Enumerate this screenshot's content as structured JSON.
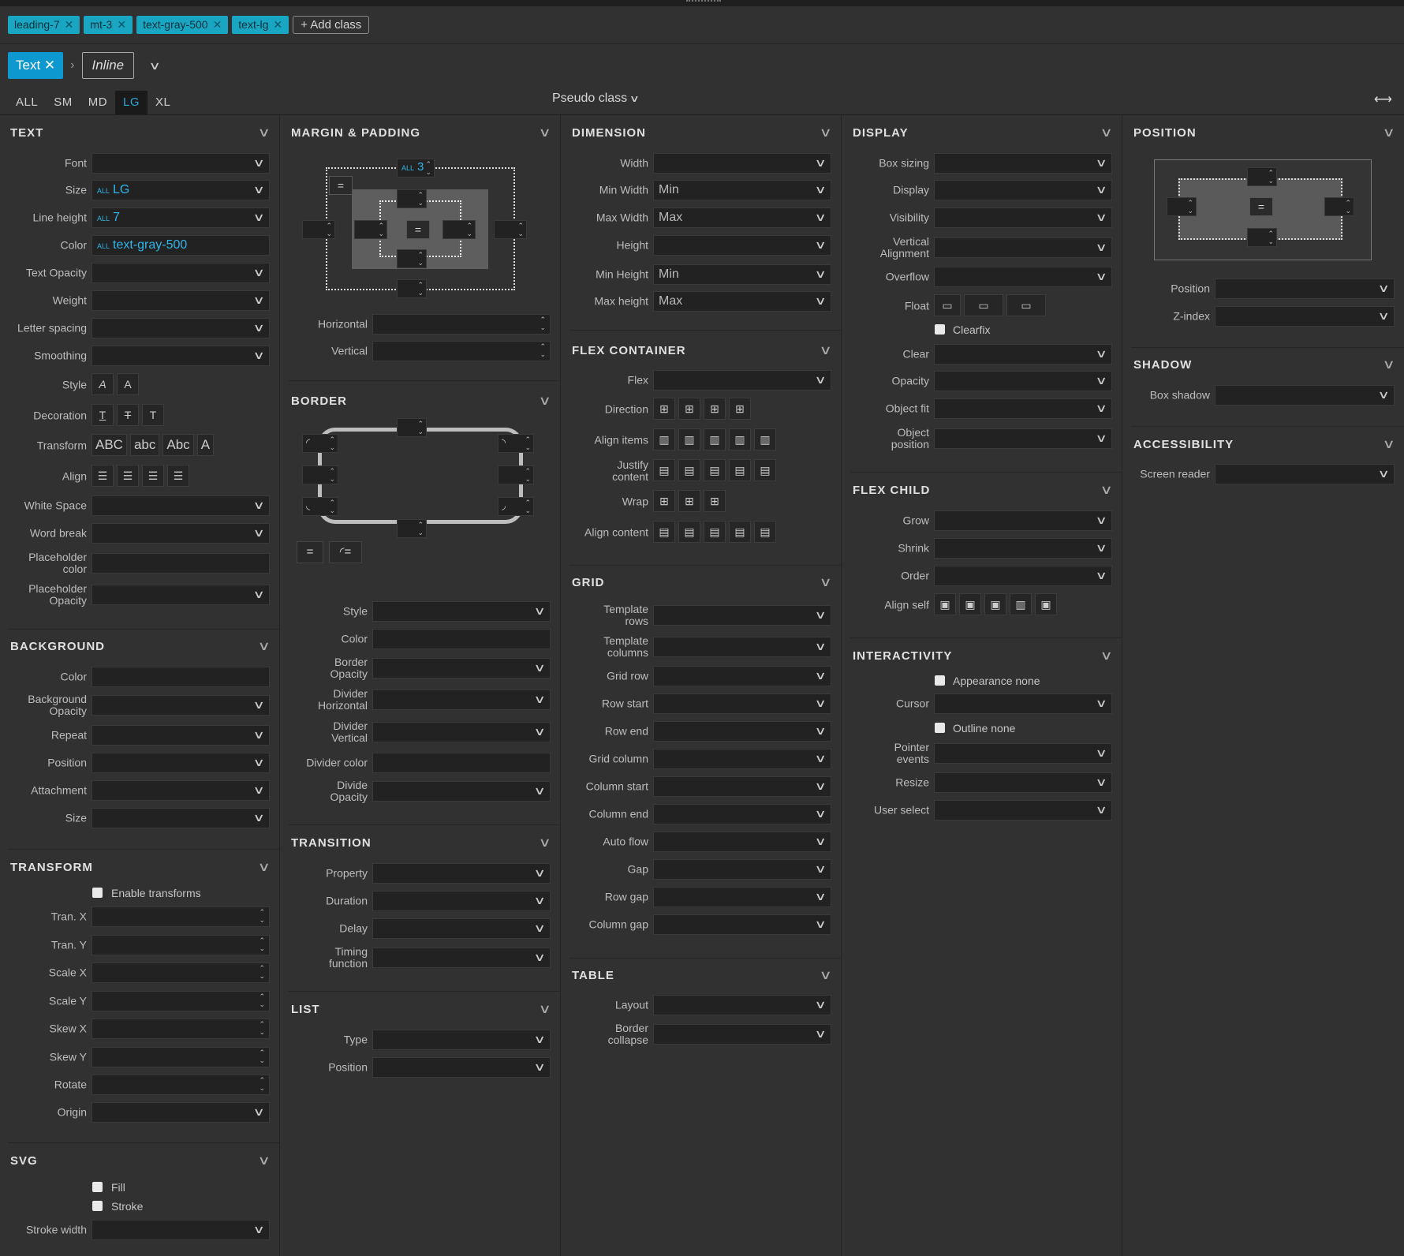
{
  "classes": {
    "items": [
      "leading-7",
      "mt-3",
      "text-gray-500",
      "text-lg"
    ],
    "add_label": "+ Add class"
  },
  "selector": {
    "tag": "Text",
    "state": "Inline"
  },
  "breakpoints": {
    "items": [
      "ALL",
      "SM",
      "MD",
      "LG",
      "XL"
    ],
    "active": "LG"
  },
  "pseudo_label": "Pseudo class",
  "text": {
    "title": "TEXT",
    "font": "Font",
    "size": "Size",
    "size_all": "ALL",
    "size_val": "LG",
    "lh": "Line height",
    "lh_all": "ALL",
    "lh_val": "7",
    "color": "Color",
    "color_all": "ALL",
    "color_val": "text-gray-500",
    "opacity": "Text Opacity",
    "weight": "Weight",
    "ls": "Letter spacing",
    "smooth": "Smoothing",
    "style": "Style",
    "style_a": "A",
    "style_b": "A",
    "deco": "Decoration",
    "deco_a": "T",
    "deco_b": "T",
    "deco_c": "T",
    "transform": "Transform",
    "tr_a": "ABC",
    "tr_b": "abc",
    "tr_c": "Abc",
    "tr_d": "A",
    "align": "Align",
    "ws": "White Space",
    "wb": "Word break",
    "ph1": "Placeholder",
    "ph1b": "color",
    "ph2": "Placeholder",
    "ph2b": "Opacity"
  },
  "background": {
    "title": "BACKGROUND",
    "color": "Color",
    "op1": "Background",
    "op2": "Opacity",
    "repeat": "Repeat",
    "position": "Position",
    "attach": "Attachment",
    "size": "Size"
  },
  "transform": {
    "title": "TRANSFORM",
    "enable": "Enable transforms",
    "tx": "Tran. X",
    "ty": "Tran. Y",
    "sx": "Scale X",
    "sy": "Scale Y",
    "kx": "Skew X",
    "ky": "Skew Y",
    "rot": "Rotate",
    "origin": "Origin"
  },
  "svg": {
    "title": "SVG",
    "fill": "Fill",
    "stroke": "Stroke",
    "sw": "Stroke width"
  },
  "mp": {
    "title": "MARGIN & PADDING",
    "all": "ALL",
    "val": "3",
    "hz": "Horizontal",
    "vt": "Vertical"
  },
  "border": {
    "title": "BORDER",
    "style": "Style",
    "color": "Color",
    "bo1": "Border",
    "bo2": "Opacity",
    "dh1": "Divider",
    "dh2": "Horizontal",
    "dv1": "Divider",
    "dv2": "Vertical",
    "dc": "Divider color",
    "do1": "Divide",
    "do2": "Opacity"
  },
  "transition": {
    "title": "TRANSITION",
    "prop": "Property",
    "dur": "Duration",
    "delay": "Delay",
    "tf1": "Timing",
    "tf2": "function"
  },
  "list": {
    "title": "LIST",
    "type": "Type",
    "pos": "Position"
  },
  "dimension": {
    "title": "DIMENSION",
    "w": "Width",
    "minw": "Min Width",
    "minw_v": "Min",
    "maxw": "Max Width",
    "maxw_v": "Max",
    "h": "Height",
    "minh": "Min Height",
    "minh_v": "Min",
    "maxh": "Max height",
    "maxh_v": "Max"
  },
  "flex": {
    "title": "FLEX CONTAINER",
    "flex": "Flex",
    "dir": "Direction",
    "ai": "Align items",
    "jc1": "Justify",
    "jc2": "content",
    "wrap": "Wrap",
    "ac": "Align content"
  },
  "grid": {
    "title": "GRID",
    "tr1": "Template",
    "tr2": "rows",
    "tc1": "Template",
    "tc2": "columns",
    "gr": "Grid row",
    "rs": "Row start",
    "re": "Row end",
    "gc": "Grid column",
    "cs": "Column start",
    "ce": "Column end",
    "af": "Auto flow",
    "gap": "Gap",
    "rg": "Row gap",
    "cg": "Column gap"
  },
  "table": {
    "title": "TABLE",
    "layout": "Layout",
    "bc1": "Border",
    "bc2": "collapse"
  },
  "display": {
    "title": "DISPLAY",
    "bs": "Box sizing",
    "disp": "Display",
    "vis": "Visibility",
    "va1": "Vertical",
    "va2": "Alignment",
    "of": "Overflow",
    "float": "Float",
    "clearfix": "Clearfix",
    "clear": "Clear",
    "op": "Opacity",
    "fit": "Object fit",
    "op1": "Object",
    "op2": "position"
  },
  "flexchild": {
    "title": "FLEX CHILD",
    "grow": "Grow",
    "shrink": "Shrink",
    "order": "Order",
    "as": "Align self"
  },
  "interact": {
    "title": "INTERACTIVITY",
    "app": "Appearance none",
    "cursor": "Cursor",
    "outline": "Outline none",
    "pe1": "Pointer",
    "pe2": "events",
    "resize": "Resize",
    "us": "User select"
  },
  "position": {
    "title": "POSITION",
    "pos": "Position",
    "z": "Z-index"
  },
  "shadow": {
    "title": "SHADOW",
    "bs": "Box shadow"
  },
  "a11y": {
    "title": "ACCESSIBILITY",
    "sr": "Screen reader"
  }
}
